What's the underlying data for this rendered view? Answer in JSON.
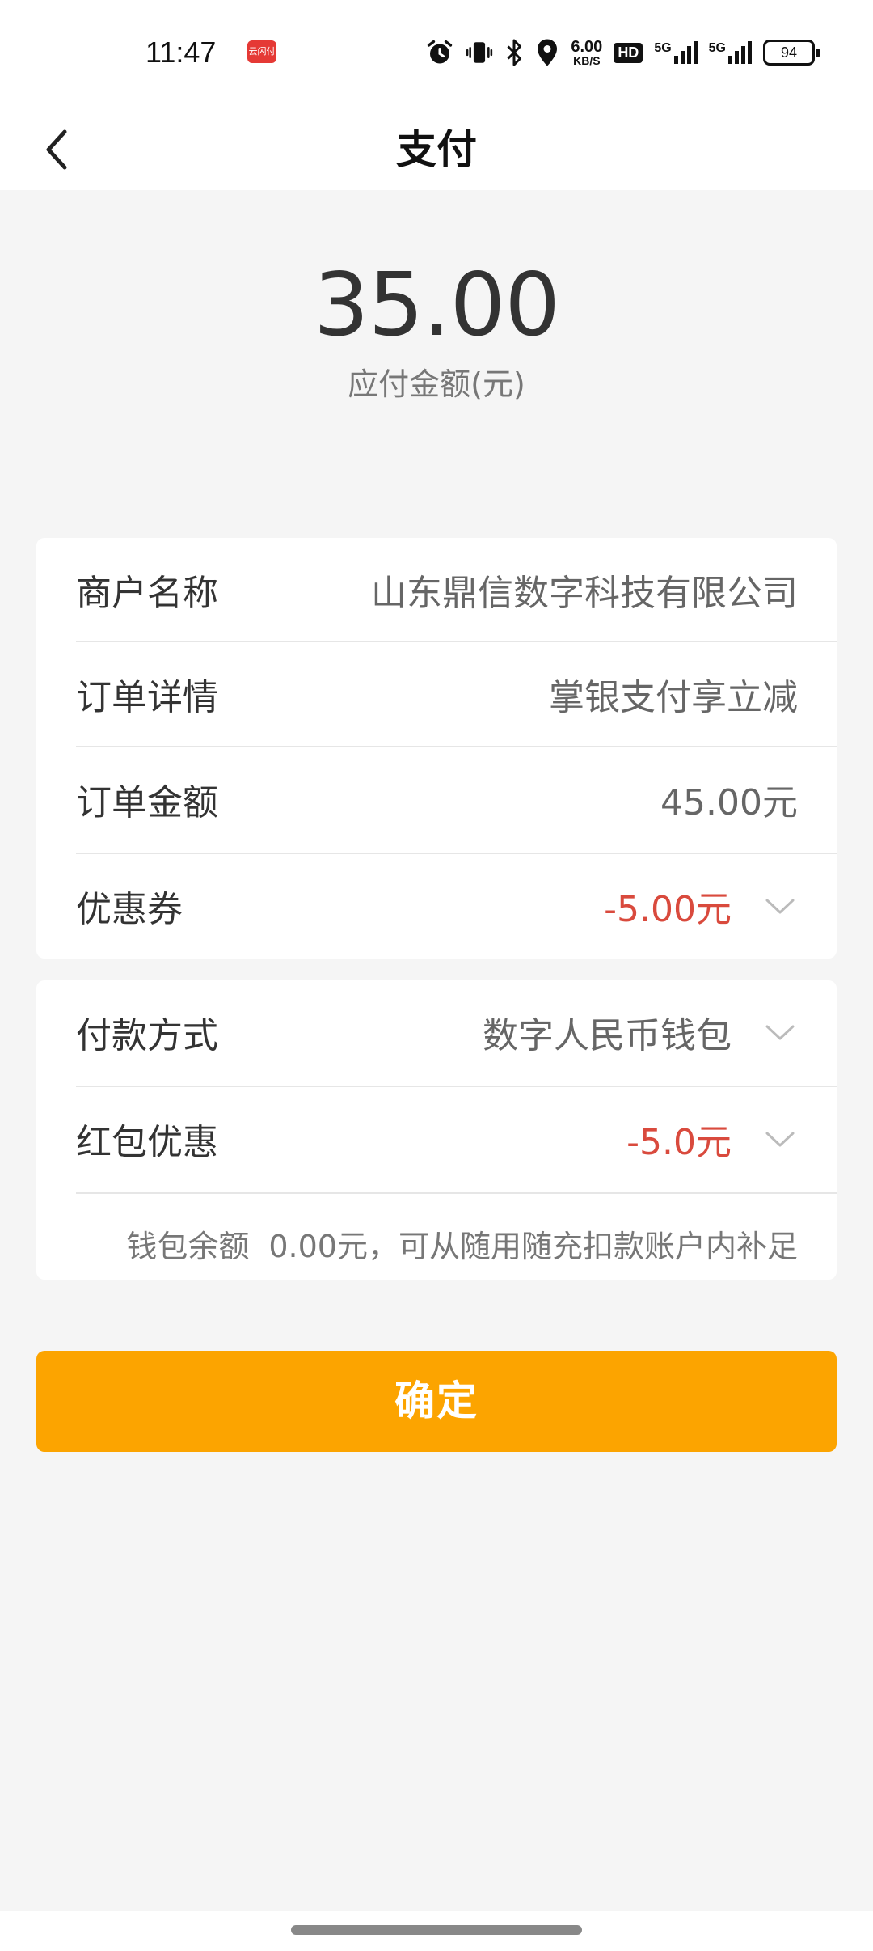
{
  "status_bar": {
    "time": "11:47",
    "app_badge": "云闪付",
    "net_speed_value": "6.00",
    "net_speed_unit": "KB/S",
    "hd_label": "HD",
    "sim1": "5G",
    "sim2": "5G",
    "battery": "94",
    "icons": [
      "alarm-icon",
      "vibrate-icon",
      "bluetooth-icon",
      "location-icon"
    ]
  },
  "header": {
    "title": "支付",
    "back_icon": "chevron-left-icon"
  },
  "summary": {
    "amount": "35.00",
    "amount_label": "应付金额(元)"
  },
  "order_card": {
    "rows": [
      {
        "label": "商户名称",
        "value": "山东鼎信数字科技有限公司"
      },
      {
        "label": "订单详情",
        "value": "掌银支付享立减"
      },
      {
        "label": "订单金额",
        "value": "45.00元"
      },
      {
        "label": "优惠券",
        "value": "-5.00元"
      }
    ]
  },
  "payment_card": {
    "method_label": "付款方式",
    "method_value": "数字人民币钱包",
    "redpacket_label": "红包优惠",
    "redpacket_value": "-5.0元",
    "balance_label": "钱包余额",
    "balance_note": "0.00元，可从随用随充扣款账户内补足"
  },
  "actions": {
    "confirm_label": "确定"
  },
  "colors": {
    "accent": "#fca400",
    "discount": "#d94a3d",
    "background": "#f5f5f5"
  }
}
